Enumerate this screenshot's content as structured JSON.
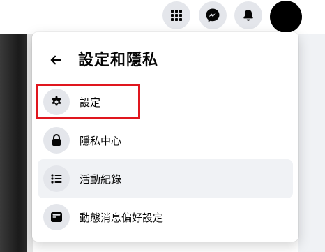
{
  "topbar": {
    "icons": [
      "grid-menu-icon",
      "messenger-icon",
      "bell-icon"
    ],
    "avatar_color": "#000000"
  },
  "popup": {
    "title": "設定和隱私",
    "back_icon": "arrow-left-icon",
    "items": [
      {
        "label": "設定",
        "icon": "gear-icon"
      },
      {
        "label": "隱私中心",
        "icon": "lock-icon"
      },
      {
        "label": "活動紀錄",
        "icon": "list-icon",
        "hovered": true
      },
      {
        "label": "動態消息偏好設定",
        "icon": "feed-icon"
      }
    ]
  },
  "annotation": {
    "highlight_color": "#e0161e",
    "highlighted_item": "設定"
  }
}
